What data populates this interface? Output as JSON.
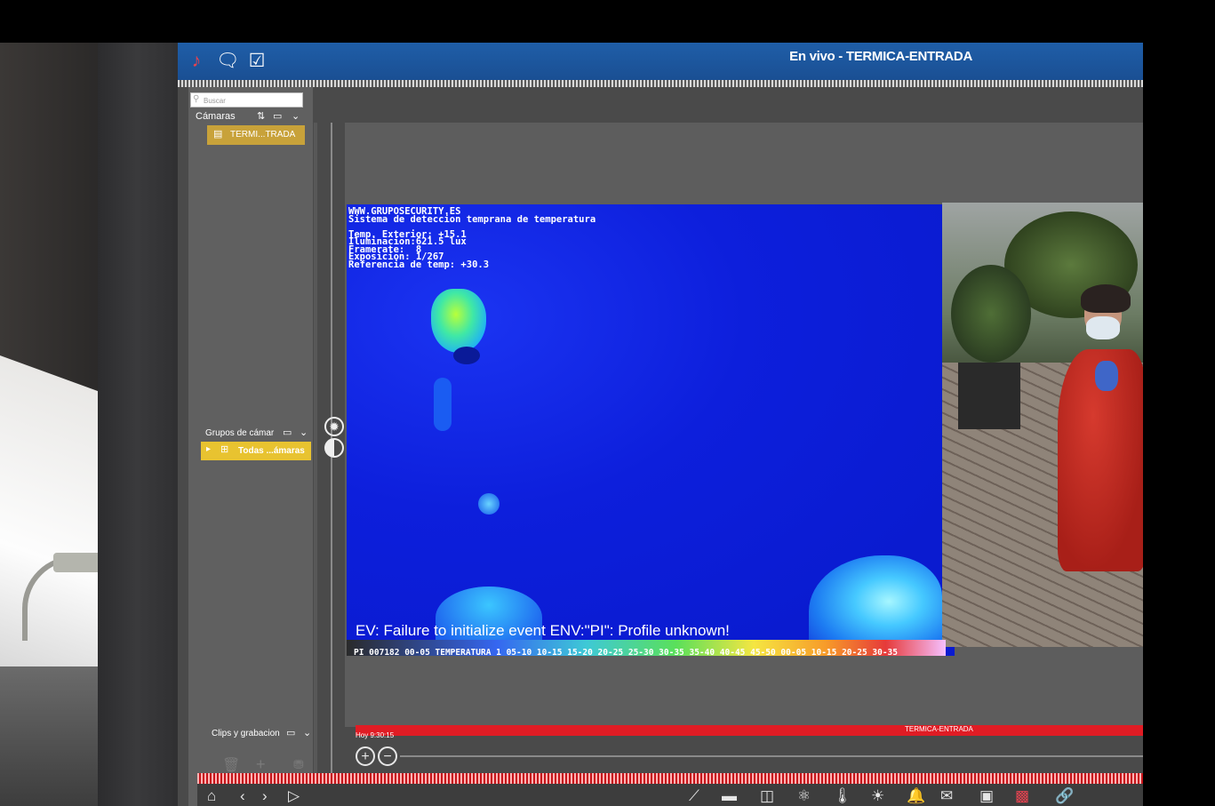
{
  "window": {
    "title": "En vivo - TERMICA-ENTRADA"
  },
  "toolbar": {
    "icons": [
      "user-icon",
      "chat-icon",
      "checkbox-icon"
    ]
  },
  "sidebar": {
    "search_placeholder": "Buscar",
    "cameras_header": "Cámaras",
    "camera_item": "TERMI...TRADA",
    "groups_header": "Grupos de cámar",
    "group_item": "Todas ...ámaras",
    "clips_header": "Clips y grabacion"
  },
  "video": {
    "overlay_lines": [
      "WWW.GRUPOSECURITY.ES",
      "Sistema de deteccion temprana de temperatura",
      "",
      "Temp. Exterior: +15.1",
      "Iluminacion:621.5 lux",
      "Framerate:  8",
      "Exposicion: 1/267",
      "Referencia de temp: +30.3"
    ],
    "error_message": "EV: Failure to initialize event ENV:\"PI\": Profile unknown!",
    "scale_text": "PI 007182 00-05 TEMPERATURA 1 05-10 10-15 15-20 20-25 25-30 30-35 35-40 40-45 45-50 00-05 10-15 20-25 30-35"
  },
  "timeline": {
    "time_label": "Hoy 9:30:15",
    "camera_label": "TERMICA-ENTRADA"
  },
  "colors": {
    "titlebar": "#1a4f93",
    "timeline": "#e01c24",
    "selection": "#e8c330"
  }
}
